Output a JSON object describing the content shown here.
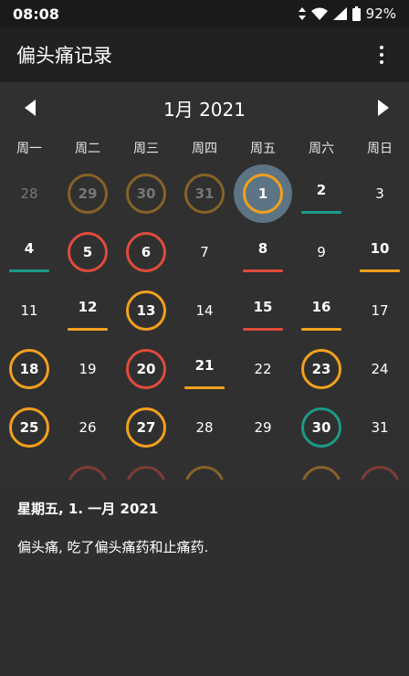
{
  "status": {
    "time": "08:08",
    "battery": "92%"
  },
  "app": {
    "title": "偏头痛记录"
  },
  "month": {
    "label": "1月 2021"
  },
  "weekdays": [
    "周一",
    "周二",
    "周三",
    "周四",
    "周五",
    "周六",
    "周日"
  ],
  "colors": {
    "red": "#e04b3c",
    "orange": "#f2a01e",
    "teal": "#1c9a88",
    "selected": "#5d7485"
  },
  "calendar": [
    [
      {
        "d": "28",
        "mark": "none",
        "faded": true
      },
      {
        "d": "29",
        "mark": "ring-orange-dim",
        "faded": true
      },
      {
        "d": "30",
        "mark": "ring-orange-dim",
        "faded": true
      },
      {
        "d": "31",
        "mark": "ring-orange-dim",
        "faded": true
      },
      {
        "d": "1",
        "mark": "ring-orange-selected"
      },
      {
        "d": "2",
        "mark": "line-teal"
      },
      {
        "d": "3",
        "mark": "none"
      }
    ],
    [
      {
        "d": "4",
        "mark": "line-teal"
      },
      {
        "d": "5",
        "mark": "ring-red"
      },
      {
        "d": "6",
        "mark": "ring-red"
      },
      {
        "d": "7",
        "mark": "none"
      },
      {
        "d": "8",
        "mark": "line-red"
      },
      {
        "d": "9",
        "mark": "none"
      },
      {
        "d": "10",
        "mark": "line-orange"
      }
    ],
    [
      {
        "d": "11",
        "mark": "none"
      },
      {
        "d": "12",
        "mark": "line-orange"
      },
      {
        "d": "13",
        "mark": "ring-orange"
      },
      {
        "d": "14",
        "mark": "none"
      },
      {
        "d": "15",
        "mark": "line-red"
      },
      {
        "d": "16",
        "mark": "line-orange"
      },
      {
        "d": "17",
        "mark": "none"
      }
    ],
    [
      {
        "d": "18",
        "mark": "ring-orange"
      },
      {
        "d": "19",
        "mark": "none"
      },
      {
        "d": "20",
        "mark": "ring-red"
      },
      {
        "d": "21",
        "mark": "line-orange"
      },
      {
        "d": "22",
        "mark": "none"
      },
      {
        "d": "23",
        "mark": "ring-orange"
      },
      {
        "d": "24",
        "mark": "none"
      }
    ],
    [
      {
        "d": "25",
        "mark": "ring-orange"
      },
      {
        "d": "26",
        "mark": "none"
      },
      {
        "d": "27",
        "mark": "ring-orange"
      },
      {
        "d": "28",
        "mark": "none"
      },
      {
        "d": "29",
        "mark": "none"
      },
      {
        "d": "30",
        "mark": "ring-teal"
      },
      {
        "d": "31",
        "mark": "none"
      }
    ],
    [
      {
        "d": "",
        "mark": "none"
      },
      {
        "d": "",
        "mark": "ring-red-dim"
      },
      {
        "d": "",
        "mark": "ring-red-dim"
      },
      {
        "d": "",
        "mark": "ring-orange-dim"
      },
      {
        "d": "",
        "mark": "none"
      },
      {
        "d": "",
        "mark": "ring-orange-dim"
      },
      {
        "d": "",
        "mark": "ring-red-dim"
      }
    ]
  ],
  "details": {
    "date": "星期五, 1. 一月 2021",
    "note": "偏头痛, 吃了偏头痛药和止痛药."
  }
}
